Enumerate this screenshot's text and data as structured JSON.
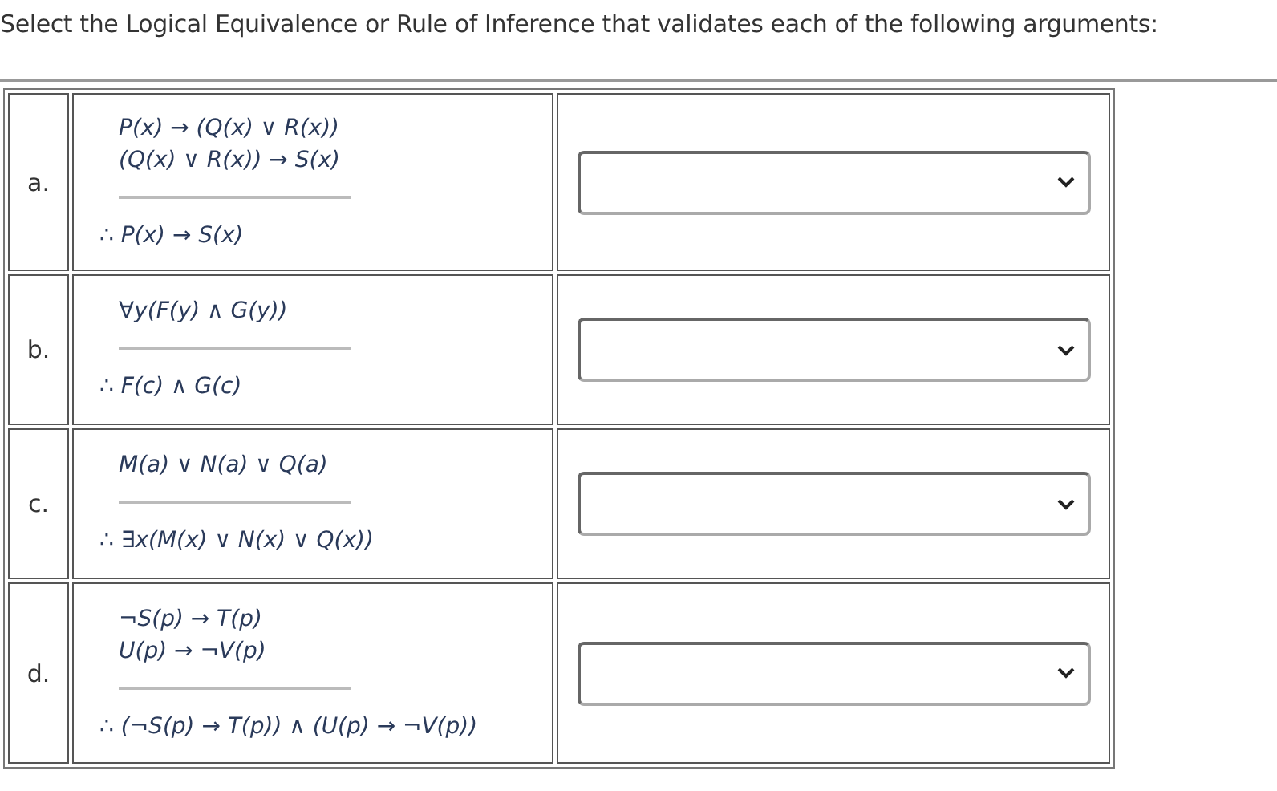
{
  "instruction": "Select the Logical Equivalence or Rule of Inference that validates each of the following arguments:",
  "arguments": [
    {
      "label": "a.",
      "premises": [
        "P(x) → (Q(x) ∨ R(x))",
        "(Q(x) ∨ R(x)) → S(x)"
      ],
      "conclusion": "∴ *P(x) → S(x)*"
    },
    {
      "label": "b.",
      "premises": [
        "∀y(F(y) ∧ G(y))"
      ],
      "conclusion": "∴ *F(c) ∧ G(c)*"
    },
    {
      "label": "c.",
      "premises": [
        "M(a) ∨ N(a) ∨ Q(a)"
      ],
      "conclusion": "∴ *∃x(M(x) ∨ N(x) ∨ Q(x))*"
    },
    {
      "label": "d.",
      "premises": [
        "¬S(p) → T(p)",
        "U(p) → ¬V(p)"
      ],
      "conclusion": "∴ *(¬S(p) → T(p)) ∧ (U(p) → ¬V(p))*"
    }
  ]
}
